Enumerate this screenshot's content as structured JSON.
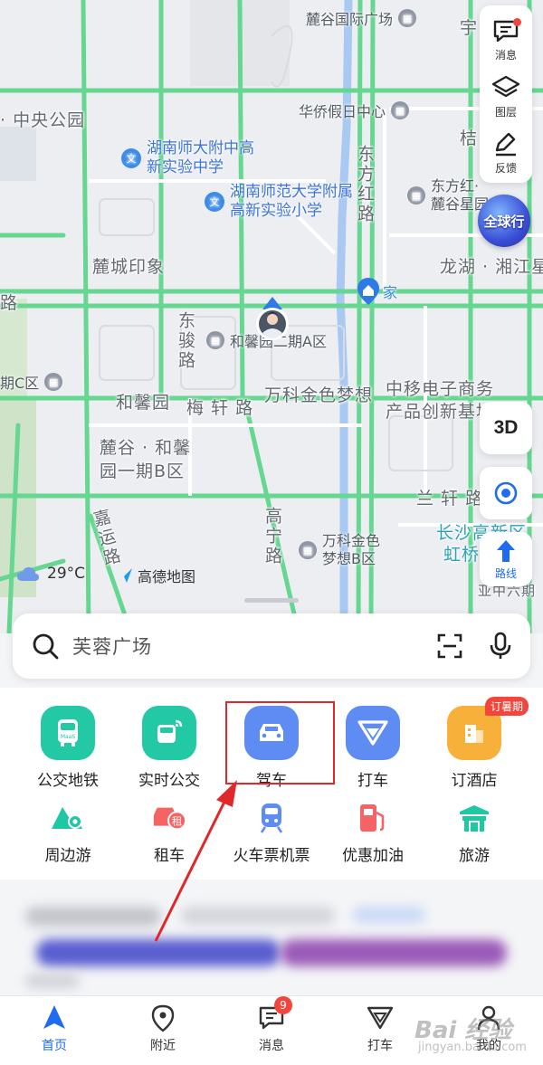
{
  "map": {
    "labels": {
      "lugu_intl": "麓谷国际广场",
      "huaqiao": "华侨假日中心",
      "zhongyang_park": "· 中央公园",
      "yu": "宇",
      "jie": "桔",
      "dongfang_road": "东方红路",
      "dongfanghong": "东方红·",
      "lugu_xingyuan": "麓谷星园",
      "longhu": "龙湖 · 湘江星",
      "lucheng": "麓城印象",
      "road_left": "路",
      "hexin_phase2": "和馨园二期A区",
      "dongjun_road": "东骏路",
      "qi_c": "期C区",
      "hexin_garden": "和馨园",
      "meixuan_road": "梅 轩 路",
      "vanke_dream": "万科金色梦想",
      "china_mobile": "中移电子商务产品创新基地",
      "lugu_hexin": "麓谷 · 和馨",
      "lugu_hexin2": "园一期B区",
      "lanxuan_road": "兰 轩 路",
      "changsha_gaoxin": "长沙高新区",
      "hongqiao": "虹桥",
      "jiayun_road": "嘉运路",
      "gaoning_road": "高宁路",
      "vanke_b1": "万科金色",
      "vanke_b2": "梦想B区",
      "yahua": "亚中六期",
      "home": "家"
    },
    "schools": {
      "school1": "湖南师大附中高新实验中学",
      "school2": "湖南师范大学附属高新实验小学"
    },
    "controls": {
      "message": "消息",
      "layers": "图层",
      "feedback": "反馈",
      "three_d": "3D",
      "route": "路线",
      "globe": "全球行"
    },
    "weather": "29°C",
    "brand": "高德地图"
  },
  "search": {
    "placeholder": "芙蓉广场"
  },
  "quick": {
    "row1": [
      {
        "label": "公交地铁",
        "icon": "bus-icon"
      },
      {
        "label": "实时公交",
        "icon": "realtime-bus-icon"
      },
      {
        "label": "驾车",
        "icon": "car-icon"
      },
      {
        "label": "打车",
        "icon": "taxi-icon"
      },
      {
        "label": "订酒店",
        "icon": "hotel-icon",
        "badge": "订暑期"
      }
    ],
    "row2": [
      {
        "label": "周边游",
        "icon": "nearby-trip-icon"
      },
      {
        "label": "租车",
        "icon": "car-rental-icon",
        "badge_small": "租"
      },
      {
        "label": "火车票机票",
        "icon": "train-icon"
      },
      {
        "label": "优惠加油",
        "icon": "fuel-icon"
      },
      {
        "label": "旅游",
        "icon": "tourism-icon"
      }
    ]
  },
  "nav": [
    {
      "label": "首页",
      "icon": "home-nav-icon"
    },
    {
      "label": "附近",
      "icon": "location-pin-icon"
    },
    {
      "label": "消息",
      "icon": "message-icon",
      "badge": "9"
    },
    {
      "label": "打车",
      "icon": "taxi-icon"
    },
    {
      "label": "我的",
      "icon": "profile-icon"
    }
  ],
  "watermark": {
    "main": "Bai 经验",
    "sub": "jingyan.baidu.com"
  },
  "colors": {
    "road_green": "#65d790",
    "active_blue": "#1f6cf0",
    "annotation_red": "#e0282a",
    "accent_teal": "#1fc7a5"
  }
}
